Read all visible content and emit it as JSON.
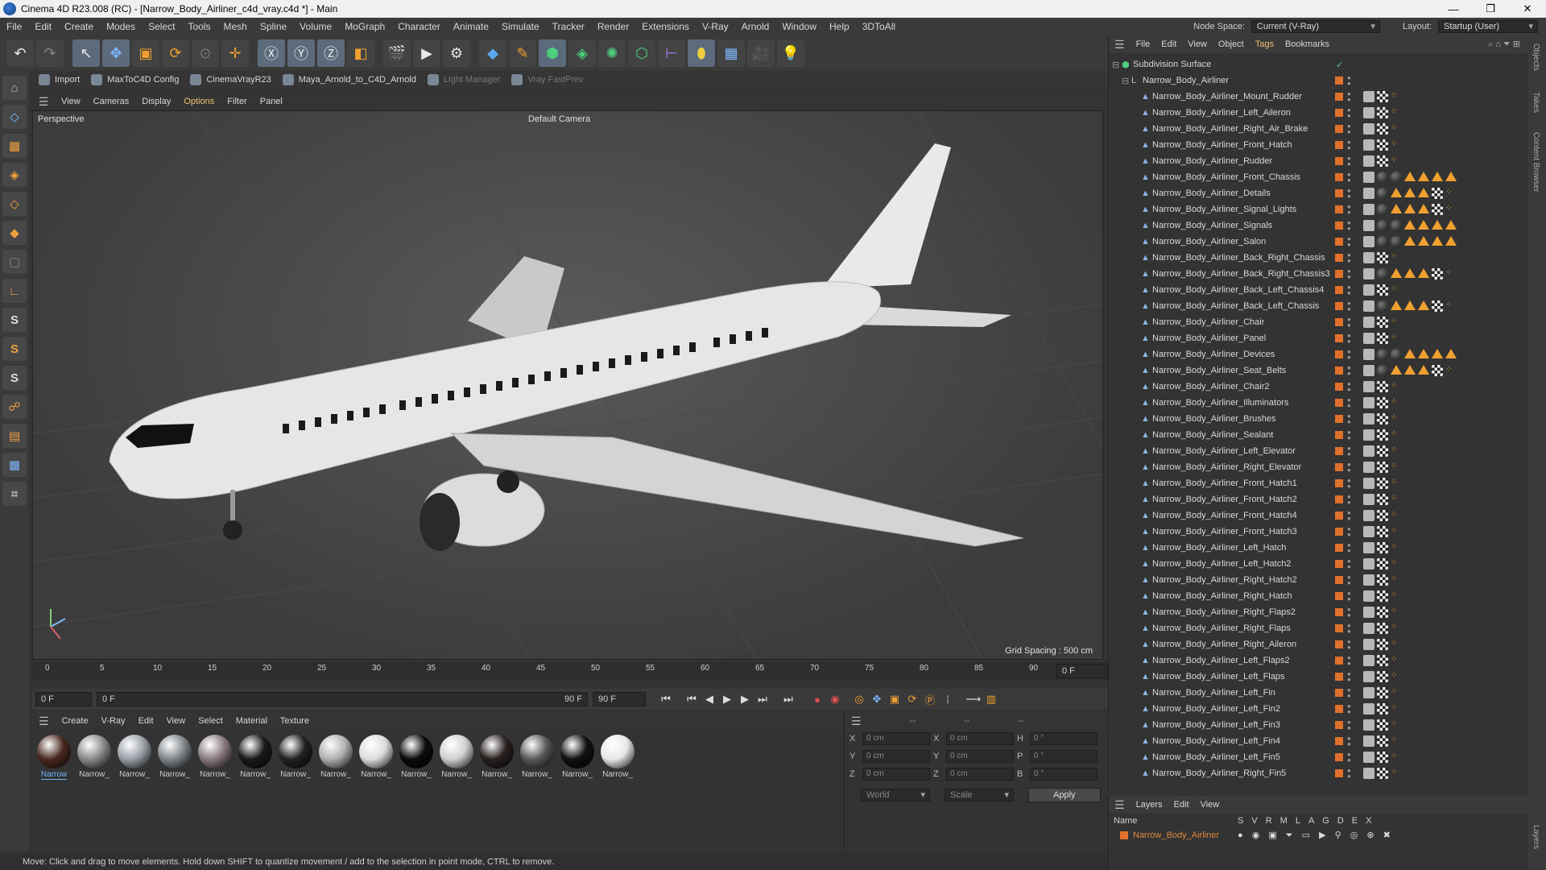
{
  "window": {
    "title": "Cinema 4D R23.008 (RC) - [Narrow_Body_Airliner_c4d_vray.c4d *] - Main",
    "minimize": "—",
    "maximize": "❐",
    "close": "✕"
  },
  "menu": [
    "File",
    "Edit",
    "Create",
    "Modes",
    "Select",
    "Tools",
    "Mesh",
    "Spline",
    "Volume",
    "MoGraph",
    "Character",
    "Animate",
    "Simulate",
    "Tracker",
    "Render",
    "Extensions",
    "V-Ray",
    "Arnold",
    "Window",
    "Help",
    "3DToAll"
  ],
  "node_space": {
    "label": "Node Space:",
    "value": "Current (V-Ray)"
  },
  "layout": {
    "label": "Layout:",
    "value": "Startup (User)"
  },
  "plugins": [
    {
      "label": "Import",
      "dim": false
    },
    {
      "label": "MaxToC4D Config",
      "dim": false
    },
    {
      "label": "CinemaVrayR23",
      "dim": false
    },
    {
      "label": "Maya_Arnold_to_C4D_Arnold",
      "dim": false
    },
    {
      "label": "Light Manager",
      "dim": true
    },
    {
      "label": "Vray FastPrev",
      "dim": true
    }
  ],
  "viewport_menu": [
    "View",
    "Cameras",
    "Display",
    "Options",
    "Filter",
    "Panel"
  ],
  "viewport": {
    "projection": "Perspective",
    "camera": "Default Camera",
    "grid_spacing": "Grid Spacing : 500 cm"
  },
  "timeline": {
    "ticks": [
      "0",
      "5",
      "10",
      "15",
      "20",
      "25",
      "30",
      "35",
      "40",
      "45",
      "50",
      "55",
      "60",
      "65",
      "70",
      "75",
      "80",
      "85",
      "90"
    ],
    "current_frame": "0 F",
    "start": "0 F",
    "range_start": "0 F",
    "range_end": "90 F",
    "end": "90 F"
  },
  "material_menu": [
    "Create",
    "V-Ray",
    "Edit",
    "View",
    "Select",
    "Material",
    "Texture"
  ],
  "materials": [
    {
      "label": "Narrow",
      "color": "#4a2a20"
    },
    {
      "label": "Narrow_",
      "color": "#8a8a8a"
    },
    {
      "label": "Narrow_",
      "color": "#9aa0a8"
    },
    {
      "label": "Narrow_",
      "color": "#80868c"
    },
    {
      "label": "Narrow_",
      "color": "#8a7a80"
    },
    {
      "label": "Narrow_",
      "color": "#1a1a1a"
    },
    {
      "label": "Narrow_",
      "color": "#222"
    },
    {
      "label": "Narrow_",
      "color": "#b0b0b0"
    },
    {
      "label": "Narrow_",
      "color": "#ddd"
    },
    {
      "label": "Narrow_",
      "color": "#0c0c0c"
    },
    {
      "label": "Narrow_",
      "color": "#d0d0d0"
    },
    {
      "label": "Narrow_",
      "color": "#2a2020"
    },
    {
      "label": "Narrow_",
      "color": "#5a5a5a"
    },
    {
      "label": "Narrow_",
      "color": "#111"
    },
    {
      "label": "Narrow_",
      "color": "#e8e8e8"
    }
  ],
  "coords": {
    "header": [
      "--",
      "--",
      "--"
    ],
    "rows": [
      {
        "a": "X",
        "av": "0 cm",
        "b": "X",
        "bv": "0 cm",
        "c": "H",
        "cv": "0 °"
      },
      {
        "a": "Y",
        "av": "0 cm",
        "b": "Y",
        "bv": "0 cm",
        "c": "P",
        "cv": "0 °"
      },
      {
        "a": "Z",
        "av": "0 cm",
        "b": "Z",
        "bv": "0 cm",
        "c": "B",
        "cv": "0 °"
      }
    ],
    "mode": "World",
    "scale": "Scale",
    "apply": "Apply"
  },
  "status": "Move: Click and drag to move elements. Hold down SHIFT to quantize movement / add to the selection in point mode, CTRL to remove.",
  "object_menu": [
    "File",
    "Edit",
    "View",
    "Object",
    "Tags",
    "Bookmarks"
  ],
  "objects": {
    "root": "Subdivision Surface",
    "group": "Narrow_Body_Airliner",
    "items": [
      "Narrow_Body_Airliner_Mount_Rudder",
      "Narrow_Body_Airliner_Left_Aileron",
      "Narrow_Body_Airliner_Right_Air_Brake",
      "Narrow_Body_Airliner_Front_Hatch",
      "Narrow_Body_Airliner_Rudder",
      "Narrow_Body_Airliner_Front_Chassis",
      "Narrow_Body_Airliner_Details",
      "Narrow_Body_Airliner_Signal_Lights",
      "Narrow_Body_Airliner_Signals",
      "Narrow_Body_Airliner_Salon",
      "Narrow_Body_Airliner_Back_Right_Chassis",
      "Narrow_Body_Airliner_Back_Right_Chassis3",
      "Narrow_Body_Airliner_Back_Left_Chassis4",
      "Narrow_Body_Airliner_Back_Left_Chassis",
      "Narrow_Body_Airliner_Chair",
      "Narrow_Body_Airliner_Panel",
      "Narrow_Body_Airliner_Devices",
      "Narrow_Body_Airliner_Seat_Belts",
      "Narrow_Body_Airliner_Chair2",
      "Narrow_Body_Airliner_Illuminators",
      "Narrow_Body_Airliner_Brushes",
      "Narrow_Body_Airliner_Sealant",
      "Narrow_Body_Airliner_Left_Elevator",
      "Narrow_Body_Airliner_Right_Elevator",
      "Narrow_Body_Airliner_Front_Hatch1",
      "Narrow_Body_Airliner_Front_Hatch2",
      "Narrow_Body_Airliner_Front_Hatch4",
      "Narrow_Body_Airliner_Front_Hatch3",
      "Narrow_Body_Airliner_Left_Hatch",
      "Narrow_Body_Airliner_Left_Hatch2",
      "Narrow_Body_Airliner_Right_Hatch2",
      "Narrow_Body_Airliner_Right_Hatch",
      "Narrow_Body_Airliner_Right_Flaps2",
      "Narrow_Body_Airliner_Right_Flaps",
      "Narrow_Body_Airliner_Right_Aileron",
      "Narrow_Body_Airliner_Left_Flaps2",
      "Narrow_Body_Airliner_Left_Flaps",
      "Narrow_Body_Airliner_Left_Fin",
      "Narrow_Body_Airliner_Left_Fin2",
      "Narrow_Body_Airliner_Left_Fin3",
      "Narrow_Body_Airliner_Left_Fin4",
      "Narrow_Body_Airliner_Left_Fin5",
      "Narrow_Body_Airliner_Right_Fin5"
    ]
  },
  "right_tabs": [
    "Objects",
    "Takes",
    "Content Browser"
  ],
  "right_tabs_bottom": [
    "Layers"
  ],
  "layers_menu": [
    "Layers",
    "Edit",
    "View"
  ],
  "layers": {
    "col_name": "Name",
    "cols": [
      "S",
      "V",
      "R",
      "M",
      "L",
      "A",
      "G",
      "D",
      "E",
      "X"
    ],
    "row": "Narrow_Body_Airliner"
  }
}
